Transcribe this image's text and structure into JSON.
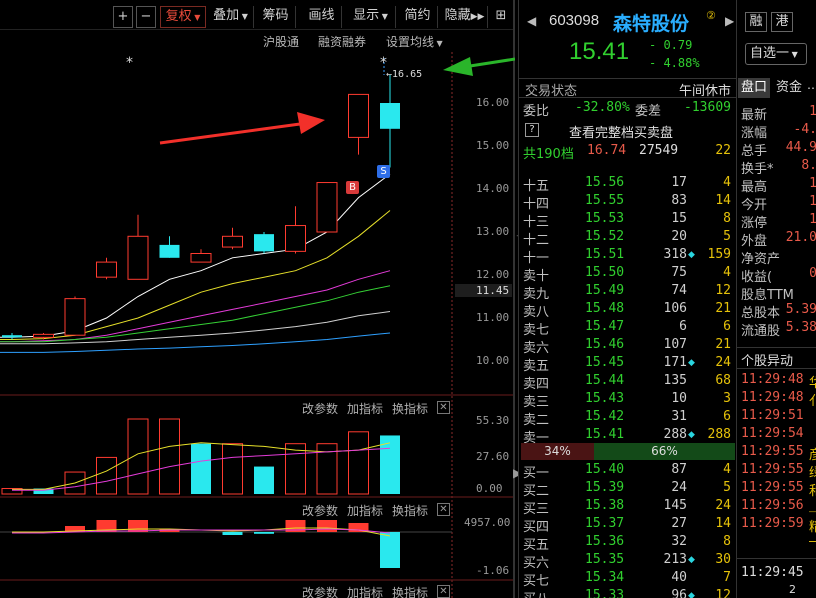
{
  "toolbar": {
    "plus": "+",
    "minus": "−",
    "fuquan": "复权",
    "diejia": "叠加",
    "chouma": "筹码",
    "huaxian": "画线",
    "xianshi": "显示",
    "jianyue": "简约",
    "yincang": "隐藏",
    "tools": "⊞"
  },
  "sublinks": {
    "hugutong": "沪股通",
    "rongzi": "融资融券",
    "junxian": "设置均线"
  },
  "price_axis": [
    "16.00",
    "15.00",
    "14.00",
    "13.00",
    "12.00",
    "11.45",
    "11.00",
    "10.00"
  ],
  "high_label": "16.65",
  "markers": {
    "b": "B",
    "s": "S",
    "star": "*"
  },
  "vol_axis": [
    "55.30",
    "27.60",
    "0.00"
  ],
  "macd_axis": [
    "4957.00",
    "-1.06"
  ],
  "controls": {
    "gai": "改参数",
    "jia": "加指标",
    "huan": "换指标",
    "close": "✕"
  },
  "chart_data": [
    {
      "type": "candlestick",
      "title": "",
      "yticks": [
        16.0,
        15.0,
        14.0,
        13.0,
        12.0,
        11.0,
        10.0
      ],
      "ylim": [
        9.7,
        16.8
      ],
      "candles": [
        {
          "o": 10.6,
          "c": 10.55,
          "h": 10.65,
          "l": 10.5,
          "dir": "down"
        },
        {
          "o": 10.55,
          "c": 10.62,
          "h": 10.65,
          "l": 10.5,
          "dir": "up"
        },
        {
          "o": 10.6,
          "c": 11.45,
          "h": 11.5,
          "l": 10.6,
          "dir": "up"
        },
        {
          "o": 12.3,
          "c": 11.95,
          "h": 12.4,
          "l": 11.9,
          "dir": "up"
        },
        {
          "o": 11.9,
          "c": 12.9,
          "h": 13.4,
          "l": 11.9,
          "dir": "up"
        },
        {
          "o": 12.7,
          "c": 12.4,
          "h": 12.9,
          "l": 12.4,
          "dir": "down"
        },
        {
          "o": 12.3,
          "c": 12.5,
          "h": 12.6,
          "l": 12.3,
          "dir": "up"
        },
        {
          "o": 12.65,
          "c": 12.9,
          "h": 13.1,
          "l": 12.6,
          "dir": "up"
        },
        {
          "o": 12.95,
          "c": 12.55,
          "h": 13.0,
          "l": 12.5,
          "dir": "down"
        },
        {
          "o": 12.55,
          "c": 13.15,
          "h": 13.6,
          "l": 12.5,
          "dir": "up"
        },
        {
          "o": 13.0,
          "c": 14.15,
          "h": 14.15,
          "l": 13.0,
          "dir": "up"
        },
        {
          "o": 15.2,
          "c": 16.2,
          "h": 16.2,
          "l": 14.8,
          "dir": "up"
        },
        {
          "o": 15.4,
          "c": 16.0,
          "h": 16.65,
          "l": 14.5,
          "dir": "down"
        }
      ],
      "ma_lines": [
        {
          "color": "#ffffff",
          "values": [
            10.55,
            10.58,
            10.7,
            11.0,
            11.5,
            11.9,
            12.1,
            12.4,
            12.5,
            12.6,
            13.0,
            13.8,
            14.35
          ]
        },
        {
          "color": "#e6e02a",
          "values": [
            10.5,
            10.52,
            10.6,
            10.8,
            11.0,
            11.3,
            11.6,
            11.8,
            11.95,
            12.1,
            12.4,
            12.9,
            13.5
          ]
        },
        {
          "color": "#e33bd8",
          "values": [
            10.45,
            10.47,
            10.5,
            10.6,
            10.75,
            10.9,
            11.05,
            11.2,
            11.35,
            11.5,
            11.65,
            11.9,
            12.1
          ]
        },
        {
          "color": "#35d035",
          "values": [
            10.45,
            10.45,
            10.5,
            10.55,
            10.65,
            10.75,
            10.85,
            10.95,
            11.1,
            11.25,
            11.4,
            11.6,
            11.75
          ]
        },
        {
          "color": "#d0d0d0",
          "values": [
            10.4,
            10.4,
            10.42,
            10.45,
            10.5,
            10.55,
            10.6,
            10.65,
            10.72,
            10.8,
            10.9,
            11.05,
            11.15
          ]
        },
        {
          "color": "#2ea0ff",
          "values": [
            10.2,
            10.2,
            10.22,
            10.25,
            10.28,
            10.3,
            10.33,
            10.36,
            10.4,
            10.45,
            10.5,
            10.58,
            10.65
          ]
        }
      ]
    },
    {
      "type": "bar",
      "title": "volume",
      "ylim": [
        0,
        60
      ],
      "values": [
        6,
        6,
        24,
        40,
        82,
        82,
        55,
        55,
        30,
        55,
        55,
        68,
        64
      ],
      "colors": [
        "up",
        "down",
        "up",
        "up",
        "up",
        "up",
        "down",
        "up",
        "down",
        "up",
        "up",
        "up",
        "down"
      ],
      "lines": [
        {
          "color": "#e6e02a",
          "values": [
            5,
            5,
            12,
            25,
            44,
            52,
            56,
            54,
            52,
            48,
            46,
            48,
            56
          ]
        },
        {
          "color": "#e33bd8",
          "values": [
            4,
            4,
            8,
            14,
            22,
            30,
            36,
            40,
            42,
            44,
            46,
            48,
            50
          ]
        }
      ]
    },
    {
      "type": "bar",
      "title": "macd",
      "ylim": [
        -1.06,
        4957
      ],
      "values": [
        0,
        0,
        1,
        2,
        2,
        0.5,
        0,
        -0.5,
        -0.3,
        2,
        2,
        1.5,
        -6
      ],
      "colors": [
        "up",
        "up",
        "up",
        "up",
        "up",
        "up",
        "down",
        "down",
        "down",
        "up",
        "up",
        "up",
        "down"
      ]
    }
  ],
  "quote": {
    "code": "603098",
    "name": "森特股份",
    "badge": "②",
    "price": "15.41",
    "change": "- 0.79",
    "pct": "- 4.88%",
    "rong": "融",
    "gang": "港",
    "zixuan": "自选",
    "zixuan_minus": "一",
    "status_label": "交易状态",
    "status_value": "午间休市",
    "weibi_label": "委比",
    "weibi_val": "-32.80%",
    "weicha_label": "委差",
    "weicha_val": "-13609",
    "q_mark": "?",
    "full_book": "查看完整档买卖盘",
    "total_label": "共190档",
    "total_price": "16.74",
    "total_vol": "27549",
    "total_n": "22",
    "ratio_left": "34%",
    "ratio_right": "66%"
  },
  "asks": [
    {
      "lab": "十五",
      "pr": "15.56",
      "vol": "17",
      "dot": "",
      "chg": "4"
    },
    {
      "lab": "十四",
      "pr": "15.55",
      "vol": "83",
      "dot": "",
      "chg": "14"
    },
    {
      "lab": "十三",
      "pr": "15.53",
      "vol": "15",
      "dot": "",
      "chg": "8"
    },
    {
      "lab": "十二",
      "pr": "15.52",
      "vol": "20",
      "dot": "",
      "chg": "5"
    },
    {
      "lab": "十一",
      "pr": "15.51",
      "vol": "318",
      "dot": "◆",
      "chg": "159"
    },
    {
      "lab": "卖十",
      "pr": "15.50",
      "vol": "75",
      "dot": "",
      "chg": "4"
    },
    {
      "lab": "卖九",
      "pr": "15.49",
      "vol": "74",
      "dot": "",
      "chg": "12"
    },
    {
      "lab": "卖八",
      "pr": "15.48",
      "vol": "106",
      "dot": "",
      "chg": "21"
    },
    {
      "lab": "卖七",
      "pr": "15.47",
      "vol": "6",
      "dot": "",
      "chg": "6"
    },
    {
      "lab": "卖六",
      "pr": "15.46",
      "vol": "107",
      "dot": "",
      "chg": "21"
    },
    {
      "lab": "卖五",
      "pr": "15.45",
      "vol": "171",
      "dot": "◆",
      "chg": "24"
    },
    {
      "lab": "卖四",
      "pr": "15.44",
      "vol": "135",
      "dot": "",
      "chg": "68"
    },
    {
      "lab": "卖三",
      "pr": "15.43",
      "vol": "10",
      "dot": "",
      "chg": "3"
    },
    {
      "lab": "卖二",
      "pr": "15.42",
      "vol": "31",
      "dot": "",
      "chg": "6"
    },
    {
      "lab": "卖一",
      "pr": "15.41",
      "vol": "288",
      "dot": "◆",
      "chg": "288"
    }
  ],
  "bids": [
    {
      "lab": "买一",
      "pr": "15.40",
      "vol": "87",
      "dot": "",
      "chg": "4"
    },
    {
      "lab": "买二",
      "pr": "15.39",
      "vol": "24",
      "dot": "",
      "chg": "5"
    },
    {
      "lab": "买三",
      "pr": "15.38",
      "vol": "145",
      "dot": "",
      "chg": "24"
    },
    {
      "lab": "买四",
      "pr": "15.37",
      "vol": "27",
      "dot": "",
      "chg": "14"
    },
    {
      "lab": "买五",
      "pr": "15.36",
      "vol": "32",
      "dot": "",
      "chg": "8"
    },
    {
      "lab": "买六",
      "pr": "15.35",
      "vol": "213",
      "dot": "◆",
      "chg": "30"
    },
    {
      "lab": "买七",
      "pr": "15.34",
      "vol": "40",
      "dot": "",
      "chg": "7"
    },
    {
      "lab": "买八",
      "pr": "15.33",
      "vol": "96",
      "dot": "◆",
      "chg": "12"
    }
  ],
  "right_panel": {
    "tab_pankou": "盘口",
    "tab_zijin": "资金",
    "tab_more": "⋯",
    "items": [
      {
        "lab": "最新",
        "val": "1"
      },
      {
        "lab": "涨幅",
        "val": "-4."
      },
      {
        "lab": "总手",
        "val": "44.9"
      },
      {
        "lab": "换手*",
        "val": "8."
      },
      {
        "lab": "最高",
        "val": "1"
      },
      {
        "lab": "今开",
        "val": "1"
      },
      {
        "lab": "涨停",
        "val": "1"
      },
      {
        "lab": "外盘",
        "val": "21.0"
      },
      {
        "lab": "净资产",
        "val": ""
      },
      {
        "lab": "收益(",
        "val": "0"
      },
      {
        "lab": "股息TTM",
        "val": ""
      },
      {
        "lab": "总股本",
        "val": "5.39"
      },
      {
        "lab": "流通股",
        "val": "5.38"
      }
    ],
    "alert_title": "个股异动",
    "alerts": [
      {
        "t": "11:29:48",
        "x": "华"
      },
      {
        "t": "11:29:48",
        "x": "亻"
      },
      {
        "t": "11:29:51",
        "x": ""
      },
      {
        "t": "11:29:54",
        "x": ""
      },
      {
        "t": "11:29:55",
        "x": "彦"
      },
      {
        "t": "11:29:55",
        "x": "绿"
      },
      {
        "t": "11:29:55",
        "x": "和"
      },
      {
        "t": "11:29:56",
        "x": "_L"
      },
      {
        "t": "11:29:59",
        "x": "精"
      },
      {
        "t": "",
        "x": "—"
      }
    ],
    "bottom_time": "11:29:45",
    "bottom_n": "2"
  },
  "colors": {
    "up": "#ff3b30",
    "down": "#2ae8ee",
    "green": "#31d02f",
    "accent": "#2aaeff"
  }
}
